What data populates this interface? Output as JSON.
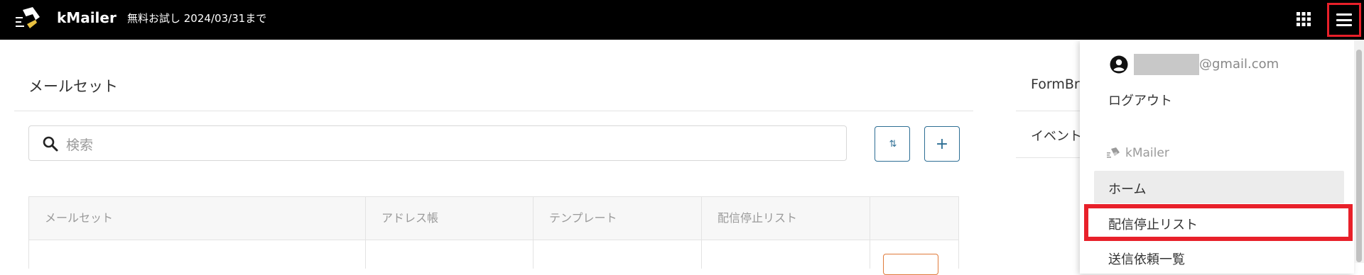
{
  "header": {
    "brand": "kMailer",
    "trial_text": "無料お試し 2024/03/31まで",
    "colors": {
      "background": "#000000",
      "text": "#ffffff",
      "highlight": "#e8202a"
    },
    "icons": [
      "kmailer-logo-icon",
      "apps-grid-icon",
      "hamburger-menu-icon"
    ]
  },
  "main": {
    "title": "メールセット",
    "search": {
      "placeholder": "検索",
      "icon": "search-icon"
    },
    "buttons": {
      "sort": "⇅",
      "add": "+"
    },
    "table": {
      "headers": [
        "メールセット",
        "アドレス帳",
        "テンプレート",
        "配信停止リスト",
        ""
      ]
    }
  },
  "right_card": {
    "title": "FormBr",
    "item": "イベント"
  },
  "dropdown": {
    "account_icon": "account-circle-icon",
    "email_domain": "@gmail.com",
    "logout": "ログアウト",
    "section": "kMailer",
    "items": [
      {
        "label": "ホーム",
        "selected": true
      },
      {
        "label": "配信停止リスト",
        "highlighted": true
      },
      {
        "label": "送信依頼一覧"
      }
    ]
  }
}
